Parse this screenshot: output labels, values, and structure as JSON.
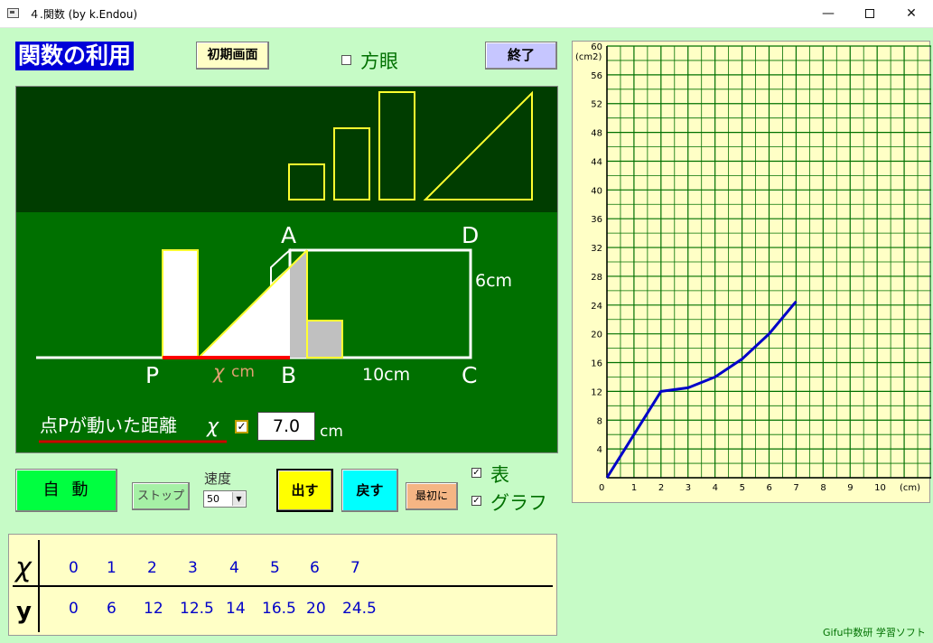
{
  "window": {
    "title": "４.関数 (by k.Endou)",
    "minimize": "—",
    "close": "✕"
  },
  "header": {
    "heading": "関数の利用",
    "initial_screen_button": "初期画面",
    "grid_label": "方眼",
    "exit_button": "終了"
  },
  "stage": {
    "point_labels": {
      "A": "A",
      "D": "D",
      "P": "P",
      "B": "B",
      "C": "C"
    },
    "height_label": "6cm",
    "base_label": "10cm",
    "x_var": "χ",
    "x_unit": "cm",
    "distance_label": "点Pが動いた距離",
    "distance_var": "χ",
    "x_value": "7.0",
    "x_value_unit": "cm",
    "x_checkbox": "✓",
    "x_position": 7
  },
  "controls": {
    "auto_button": "自動",
    "stop_button": "ストップ",
    "speed_label": "速度",
    "speed_value": "50",
    "output_button": "出す",
    "back_button": "戻す",
    "reset_button": "最初に",
    "table_label": "表",
    "graph_label": "グラフ",
    "table_checked": "✓",
    "graph_checked": "✓"
  },
  "value_table": {
    "x_header": "χ",
    "y_header": "y",
    "x_values": [
      "0",
      "1",
      "2",
      "3",
      "4",
      "5",
      "6",
      "7"
    ],
    "y_values": [
      "0",
      "6",
      "12",
      "12.5",
      "14",
      "16.5",
      "20",
      "24.5"
    ]
  },
  "chart_data": {
    "type": "line",
    "x": [
      0,
      1,
      2,
      3,
      4,
      5,
      6,
      7
    ],
    "y": [
      0,
      6,
      12,
      12.5,
      14,
      16.5,
      20,
      24.5
    ],
    "xlim": [
      0,
      12
    ],
    "ylim": [
      0,
      60
    ],
    "x_ticks": [
      "0",
      "1",
      "2",
      "3",
      "4",
      "5",
      "6",
      "7",
      "8",
      "9",
      "10"
    ],
    "y_ticks": [
      "4",
      "8",
      "12",
      "16",
      "20",
      "24",
      "28",
      "32",
      "36",
      "40",
      "44",
      "48",
      "52",
      "56",
      "60"
    ],
    "xlabel": "(cm)",
    "ylabel": "(cm2)",
    "grid": true,
    "line_color": "#0000c8",
    "grid_color": "#007000",
    "background": "#ffffc6"
  },
  "footer": {
    "credit": "Gifu中数研 学習ソフト"
  },
  "colors": {
    "stage_top": "#003d00",
    "stage_bottom": "#007000",
    "outline_yellow": "#ffff30",
    "red_segment": "#ff0000",
    "accent_blue": "#0000d8"
  }
}
